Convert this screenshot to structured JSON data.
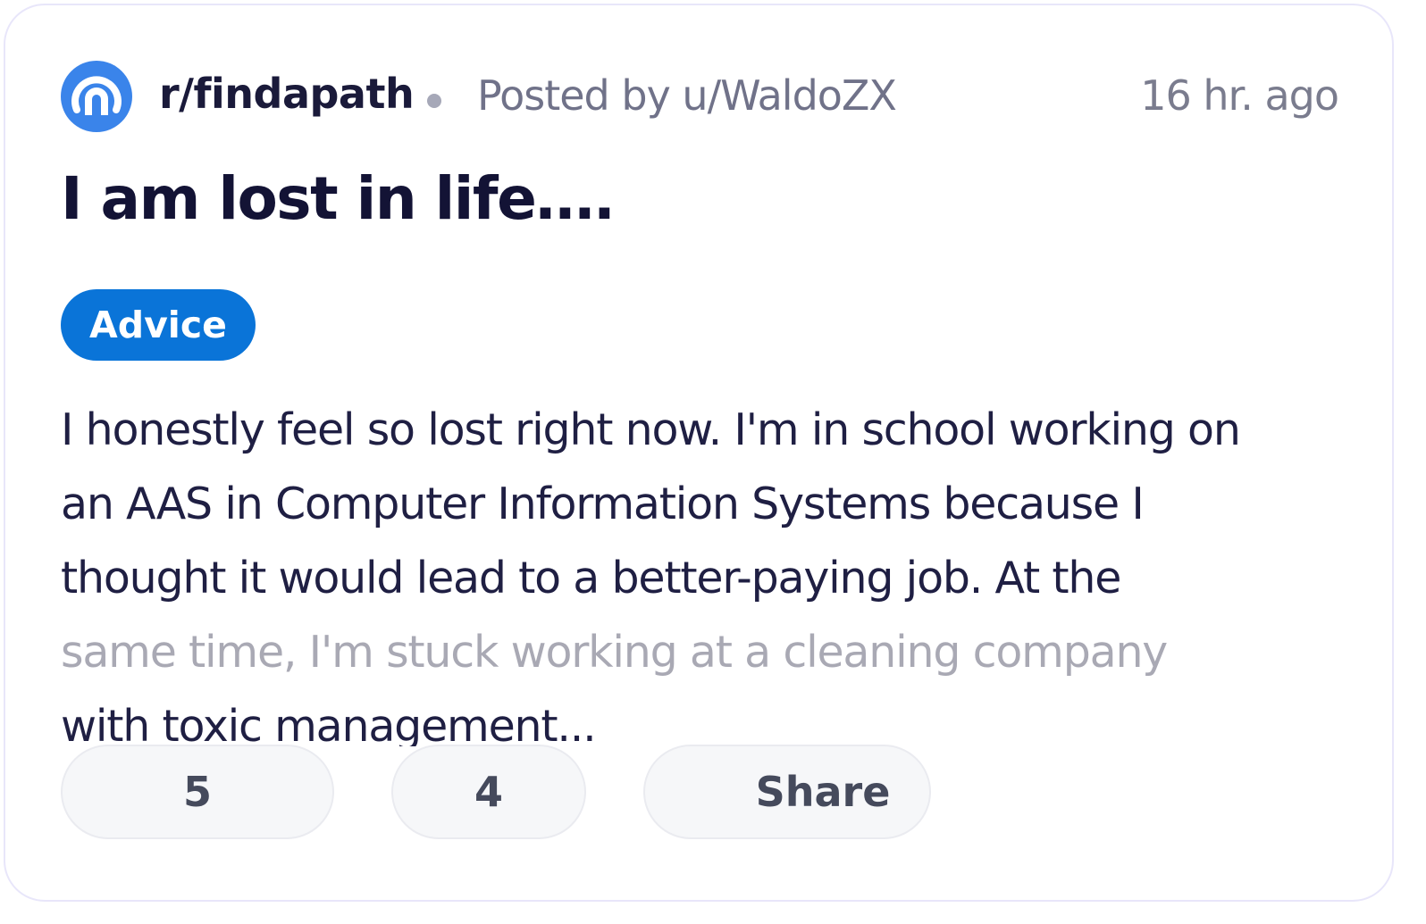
{
  "post": {
    "subreddit": "r/findapath",
    "separator_dot": "•",
    "posted_by": "Posted by u/WaldoZX",
    "timestamp": "16 hr. ago",
    "title": "I am lost in life….",
    "flair": "Advice",
    "body_lines": [
      "I honestly feel so lost right now. I'm in school working on",
      "an AAS in Computer Information Systems because I",
      "thought it would lead to a better-paying job. At the",
      "same time, I'm stuck working at a cleaning company",
      "with toxic management..."
    ]
  },
  "actions": {
    "upvotes": "5",
    "comments": "4",
    "share_label": "Share"
  },
  "colors": {
    "logo": "#3a84ea",
    "flair_bg": "#0a74d8",
    "title": "#131335",
    "muted_text": "#707289"
  },
  "icons": {
    "subreddit_logo": "subreddit-logo-icon"
  }
}
